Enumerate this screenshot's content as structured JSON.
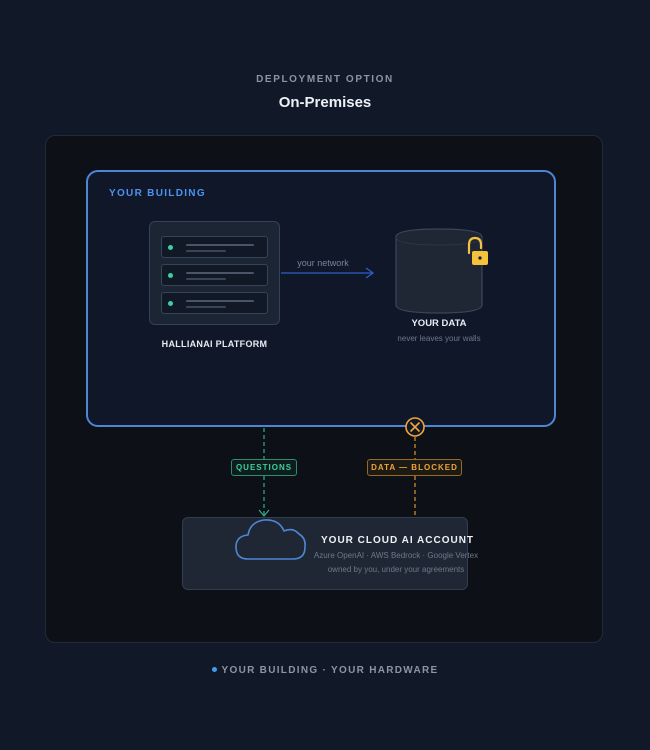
{
  "header": {
    "eyebrow": "DEPLOYMENT OPTION",
    "title": "On-Premises"
  },
  "building": {
    "label": "YOUR BUILDING",
    "platform_label": "HALLIANAI PLATFORM",
    "network_label": "your network",
    "data_label": "YOUR DATA",
    "data_sub": "never leaves your walls"
  },
  "connectors": {
    "questions_label": "QUESTIONS",
    "blocked_label": "DATA — BLOCKED"
  },
  "cloud": {
    "title": "YOUR CLOUD AI ACCOUNT",
    "providers": "Azure OpenAI · AWS Bedrock · Google Vertex",
    "owner": "owned by you, under your agreements"
  },
  "footer": {
    "text": "YOUR BUILDING · YOUR HARDWARE"
  },
  "icons": {
    "server": "server-rack-icon",
    "database": "database-icon",
    "lock": "unlocked-padlock-icon",
    "cloud": "cloud-icon",
    "blocked": "blocked-x-icon"
  },
  "colors": {
    "building_border": "#4e86d6",
    "questions": "#3ecfa2",
    "blocked": "#f0a33a",
    "lock": "#f5c33b",
    "led": "#3ccfa0"
  }
}
